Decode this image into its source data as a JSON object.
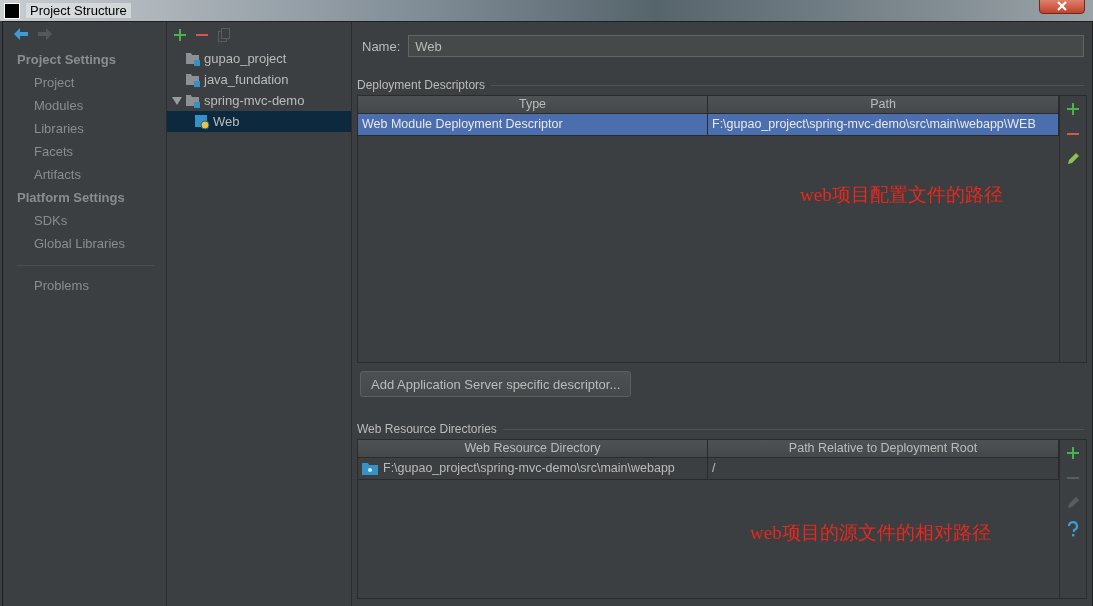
{
  "window": {
    "title": "Project Structure"
  },
  "sidebar": {
    "sections": [
      {
        "title": "Project Settings",
        "items": [
          {
            "label": "Project",
            "selected": false
          },
          {
            "label": "Modules",
            "selected": false
          },
          {
            "label": "Libraries",
            "selected": false
          },
          {
            "label": "Facets",
            "selected": false
          },
          {
            "label": "Artifacts",
            "selected": false
          }
        ]
      },
      {
        "title": "Platform Settings",
        "items": [
          {
            "label": "SDKs",
            "selected": false
          },
          {
            "label": "Global Libraries",
            "selected": false
          }
        ]
      }
    ],
    "footer_items": [
      {
        "label": "Problems",
        "selected": false
      }
    ]
  },
  "module_tree": [
    {
      "label": "gupao_project",
      "kind": "module",
      "selected": false
    },
    {
      "label": "java_fundation",
      "kind": "module",
      "selected": false
    },
    {
      "label": "spring-mvc-demo",
      "kind": "module",
      "expanded": true,
      "selected": false,
      "children": [
        {
          "label": "Web",
          "kind": "facet",
          "selected": true
        }
      ]
    }
  ],
  "name_field": {
    "label": "Name:",
    "value": "Web"
  },
  "deployment_descriptors": {
    "title": "Deployment Descriptors",
    "columns": [
      "Type",
      "Path"
    ],
    "rows": [
      {
        "cells": [
          "Web Module Deployment Descriptor",
          "F:\\gupao_project\\spring-mvc-demo\\src\\main\\webapp\\WEB"
        ],
        "selected": true
      }
    ],
    "toolbar": [
      {
        "kind": "add",
        "disabled": false
      },
      {
        "kind": "remove",
        "disabled": false
      },
      {
        "kind": "edit",
        "disabled": false
      }
    ],
    "annotation": "web项目配置文件的路径"
  },
  "add_server_button": "Add Application Server specific descriptor...",
  "web_resource_directories": {
    "title": "Web Resource Directories",
    "columns": [
      "Web Resource Directory",
      "Path Relative to Deployment Root"
    ],
    "rows": [
      {
        "cells": [
          "F:\\gupao_project\\spring-mvc-demo\\src\\main\\webapp",
          "/"
        ],
        "selected": false,
        "kind": "directory"
      }
    ],
    "toolbar": [
      {
        "kind": "add",
        "disabled": false
      },
      {
        "kind": "remove",
        "disabled": true
      },
      {
        "kind": "edit",
        "disabled": true
      },
      {
        "kind": "help",
        "disabled": false
      }
    ],
    "annotation": "web项目的源文件的相对路径"
  }
}
